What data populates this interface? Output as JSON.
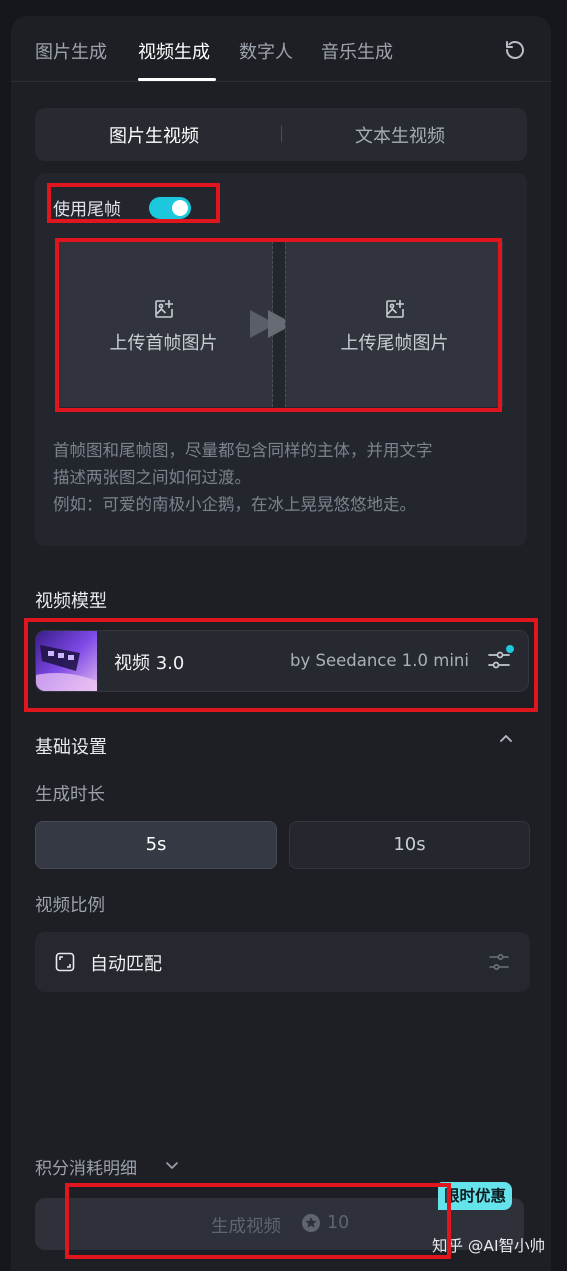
{
  "tabs": [
    {
      "label": "图片生成",
      "active": false
    },
    {
      "label": "视频生成",
      "active": true
    },
    {
      "label": "数字人",
      "active": false
    },
    {
      "label": "音乐生成",
      "active": false
    }
  ],
  "mode_switch": {
    "left": "图片生视频",
    "right": "文本生视频",
    "selected": "图片生视频"
  },
  "upload": {
    "tail_frame_label": "使用尾帧",
    "tail_frame_enabled": true,
    "first_frame_label": "上传首帧图片",
    "last_frame_label": "上传尾帧图片",
    "hint_lines": [
      "首帧图和尾帧图，尽量都包含同样的主体，并用文字",
      "描述两张图之间如何过渡。",
      "例如：可爱的南极小企鹅，在冰上晃晃悠悠地走。"
    ]
  },
  "model_section": {
    "heading": "视频模型",
    "name": "视频 3.0",
    "provider": "by Seedance 1.0 mini"
  },
  "basic_settings": {
    "heading": "基础设置",
    "duration_label": "生成时长",
    "durations": [
      "5s",
      "10s"
    ],
    "selected_duration": "5s",
    "ratio_label": "视频比例",
    "ratio_value": "自动匹配"
  },
  "footer": {
    "credits_label": "积分消耗明细",
    "generate_label": "生成视频",
    "cost": "10",
    "promo_badge": "限时优惠"
  },
  "watermark": "知乎 @AI智小帅",
  "colors": {
    "accent": "#1ec8dc",
    "highlight": "#e0161f",
    "panel": "#1d1f25",
    "badge": "#64e3ea"
  }
}
